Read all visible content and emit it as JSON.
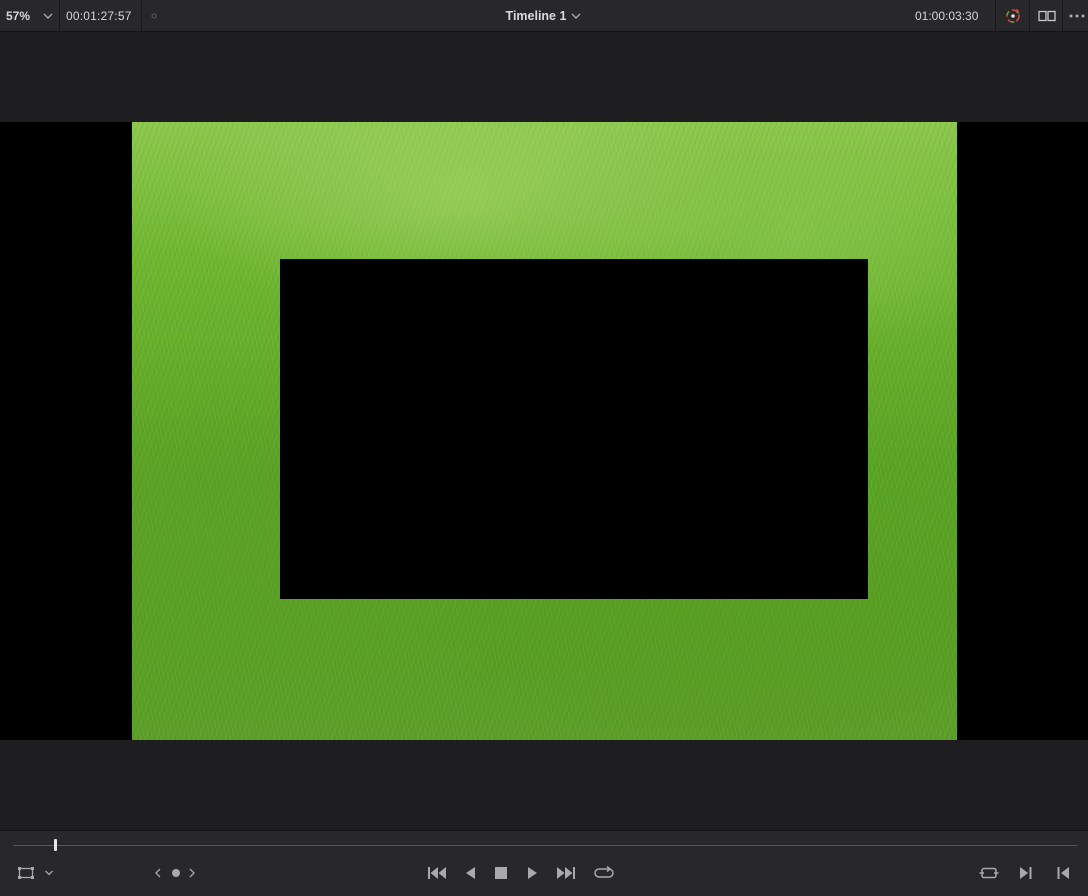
{
  "toolbar": {
    "zoom_value": "57%",
    "source_timecode": "00:01:27:57",
    "timeline_name": "Timeline 1",
    "record_timecode": "01:00:03:30",
    "icons": {
      "zoom_dropdown": "chevron-down-icon",
      "timeline_dropdown": "chevron-down-icon",
      "color_viewer": "color-wheel-icon",
      "dual_viewer": "dual-viewer-icon",
      "more": "more-options-icon"
    }
  },
  "viewer": {
    "image": "green-grass-photo",
    "mask_color": "#000000",
    "letterbox_color": "#000000"
  },
  "transport": {
    "playhead_position_fraction": 0.039,
    "icons": {
      "transform_tool": "transform-box-icon",
      "transform_dropdown": "chevron-down-icon",
      "prev_keyframe": "chevron-left-icon",
      "keyframe": "keyframe-dot-icon",
      "next_keyframe": "chevron-right-icon",
      "jump_start": "skip-to-start-icon",
      "reverse": "play-reverse-icon",
      "stop": "stop-icon",
      "play": "play-icon",
      "jump_end": "skip-to-end-icon",
      "loop": "loop-icon",
      "match_frame": "match-frame-icon",
      "next_edit": "next-edit-icon",
      "prev_edit": "prev-edit-icon"
    }
  },
  "colors": {
    "panel_bg": "#1e1e20",
    "bar_bg": "#28282b",
    "text": "#d6d6d8",
    "icon": "#a9a9ad"
  }
}
